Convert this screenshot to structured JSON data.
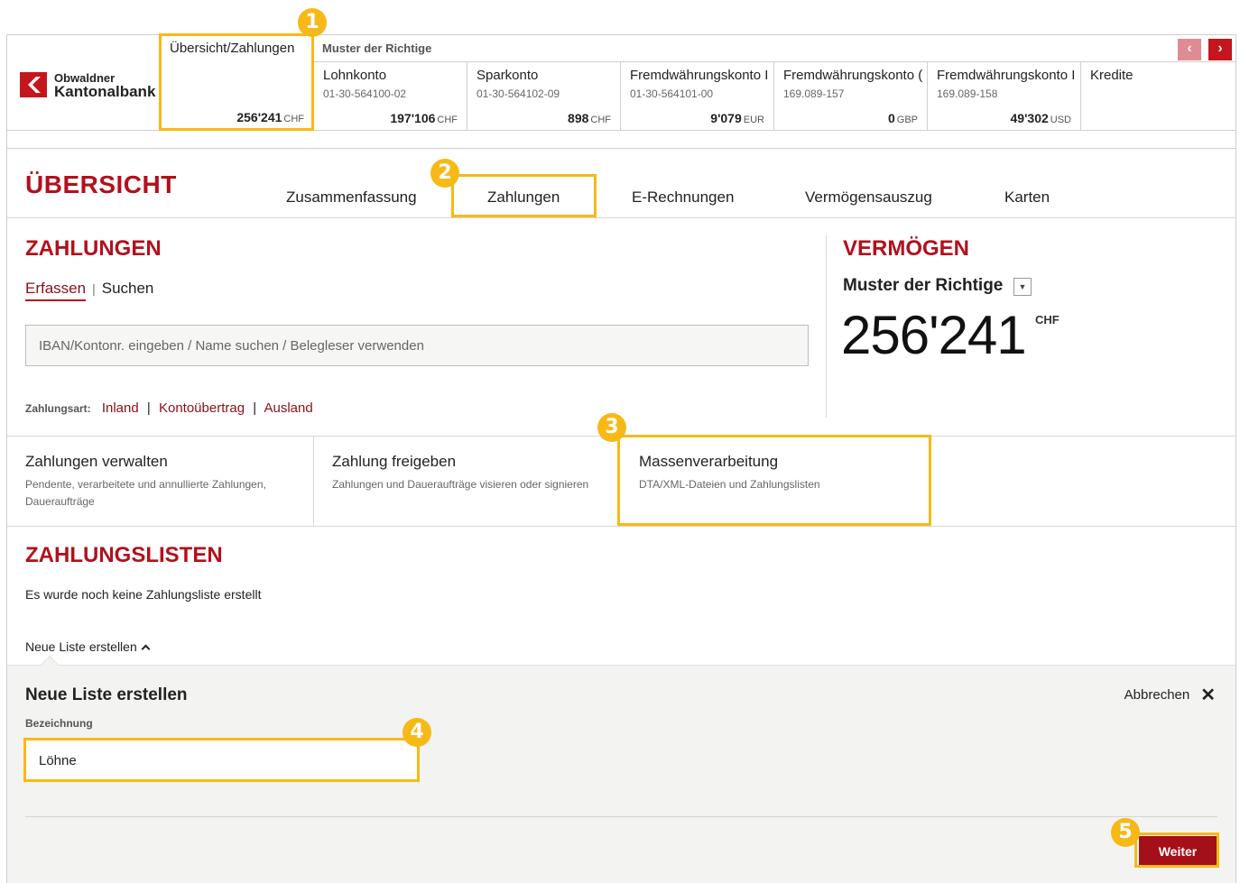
{
  "bank": {
    "name_line1": "Obwaldner",
    "name_line2": "Kantonalbank"
  },
  "overview_account": {
    "label": "Übersicht/Zahlungen",
    "amount": "256'241",
    "currency": "CHF"
  },
  "owner": "Muster der Richtige",
  "nav_prev": "‹",
  "nav_next": "›",
  "accounts": [
    {
      "name": "Lohnkonto",
      "number": "01-30-564100-02",
      "amount": "197'106",
      "currency": "CHF"
    },
    {
      "name": "Sparkonto",
      "number": "01-30-564102-09",
      "amount": "898",
      "currency": "CHF"
    },
    {
      "name": "Fremdwährungskonto I",
      "number": "01-30-564101-00",
      "amount": "9'079",
      "currency": "EUR"
    },
    {
      "name": "Fremdwährungskonto (",
      "number": "169.089-157",
      "amount": "0",
      "currency": "GBP"
    },
    {
      "name": "Fremdwährungskonto I",
      "number": "169.089-158",
      "amount": "49'302",
      "currency": "USD"
    },
    {
      "name": "Kredite",
      "number": "",
      "amount": "",
      "currency": ""
    }
  ],
  "main": {
    "title": "ÜBERSICHT",
    "tabs": [
      "Zusammenfassung",
      "Zahlungen",
      "E-Rechnungen",
      "Vermögensauszug",
      "Karten"
    ]
  },
  "payments": {
    "title": "ZAHLUNGEN",
    "subnav": {
      "active": "Erfassen",
      "other": "Suchen",
      "sep": "|"
    },
    "search_placeholder": "IBAN/Kontonr. eingeben / Name suchen / Belegleser verwenden",
    "paytype_label": "Zahlungsart:",
    "paytypes": [
      "Inland",
      "Kontoübertrag",
      "Ausland"
    ],
    "paytype_sep": "|"
  },
  "assets": {
    "title": "VERMÖGEN",
    "owner": "Muster der Richtige",
    "dropdown": "▼",
    "amount": "256'241",
    "currency": "CHF"
  },
  "tiles": [
    {
      "title": "Zahlungen verwalten",
      "desc": "Pendente, verarbeitete und annullierte Zahlungen, Daueraufträge"
    },
    {
      "title": "Zahlung freigeben",
      "desc": "Zahlungen und Daueraufträge visieren oder signieren"
    },
    {
      "title": "Massenverarbeitung",
      "desc": "DTA/XML-Dateien und Zahlungslisten"
    }
  ],
  "lists": {
    "title": "ZAHLUNGSLISTEN",
    "empty_text": "Es wurde noch keine Zahlungsliste erstellt",
    "new_link": "Neue Liste erstellen"
  },
  "new_list_panel": {
    "title": "Neue Liste erstellen",
    "cancel": "Abbrechen",
    "cancel_icon": "✕",
    "field_label": "Bezeichnung",
    "field_value": "Löhne",
    "submit": "Weiter"
  },
  "annotations": [
    "1",
    "2",
    "3",
    "4",
    "5"
  ],
  "colors": {
    "brand_red": "#b3101c",
    "highlight": "#f6b917",
    "button_red": "#a50f1a"
  }
}
